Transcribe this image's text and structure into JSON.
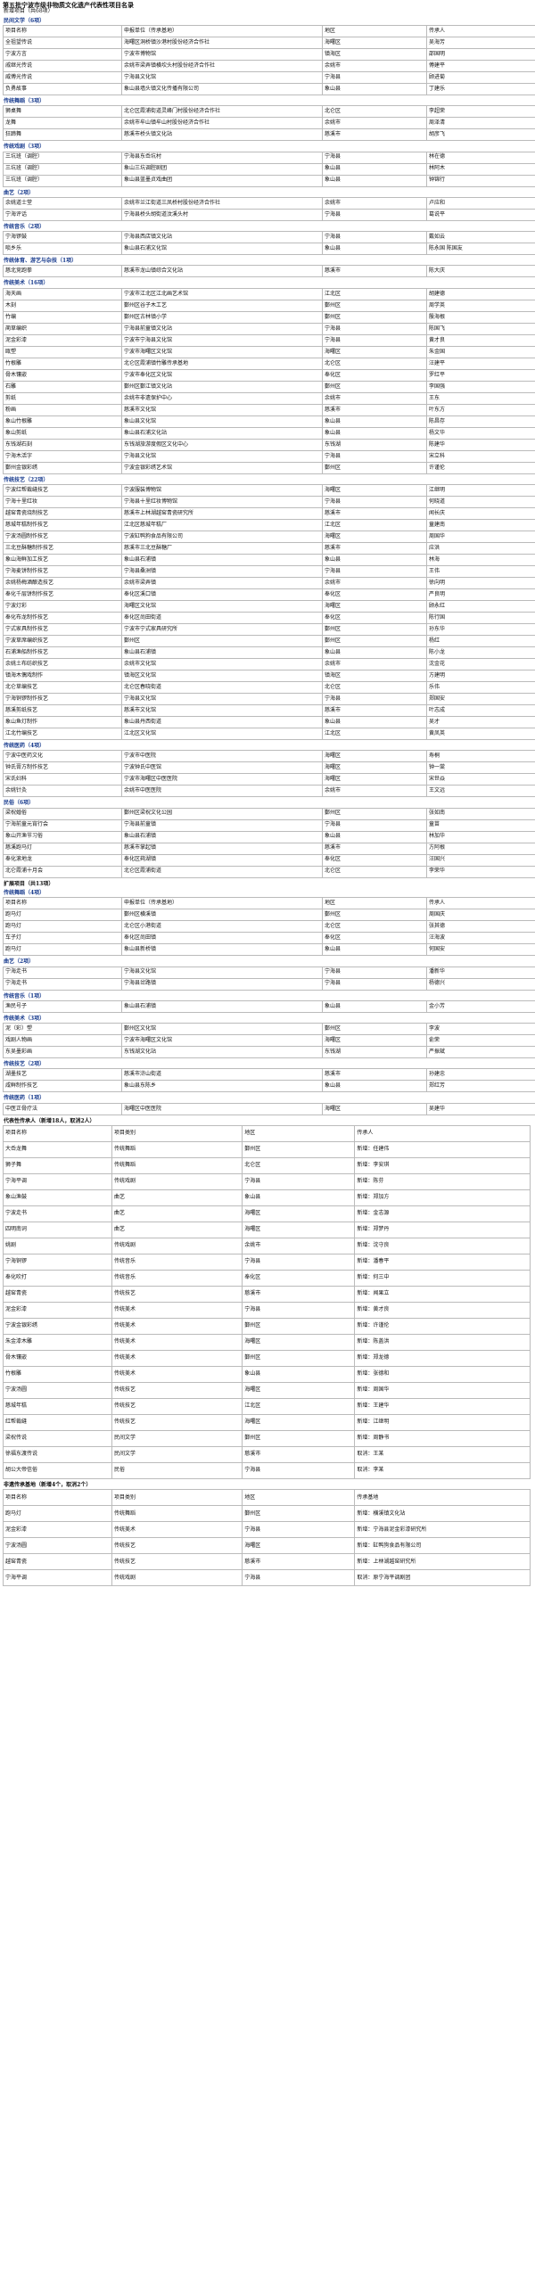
{
  "title": "第五批宁波市级非物质文化遗产代表性项目名录",
  "new_label": "新增项目（共68项）",
  "new_sections": [
    {
      "name": "民间文学（6项）",
      "rows": [
        [
          "项目名称",
          "申报单位（传承基地）",
          "地区",
          "传承人"
        ],
        [
          "全祖望传说",
          "海曙区洞桥镇沙港村股份经济合作社",
          "海曙区",
          "吴海芳"
        ],
        [
          "宁波方言",
          "宁波市博物馆",
          "镇海区",
          "邵国明"
        ],
        [
          "戚继光传说",
          "余姚市梁弄镇横坎头村股份经济合作社",
          "余姚市",
          "傅建平"
        ],
        [
          "威傅光传说",
          "宁海县文化馆",
          "宁海县",
          "顾进菊"
        ],
        [
          "负勇故事",
          "象山县墙头镇文化传播有限公司",
          "象山县",
          "丁建乐"
        ]
      ]
    },
    {
      "name": "传统舞蹈（3项）",
      "rows": [
        [
          "狮桌舞",
          "北仑区霞浦街道灵峰门村股份经济合作社",
          "北仑区",
          "李超荣"
        ],
        [
          "龙舞",
          "余姚市牟山镇牟山村股份经济合作社",
          "余姚市",
          "周泽清"
        ],
        [
          "狂蹄舞",
          "慈溪市桥头镇文化站",
          "慈溪市",
          "胡彦飞"
        ]
      ]
    },
    {
      "name": "传统戏剧（3项）",
      "rows": [
        [
          "三坑班（调腔）",
          "宁海县东岙坑村",
          "宁海县",
          "林在德"
        ],
        [
          "三坑班（调腔）",
          "象山三坑调腔剧团",
          "象山县",
          "林阿木"
        ],
        [
          "三坑班（调腔）",
          "象山县蓝墨贞戏曲团",
          "象山县",
          "钟锦行"
        ]
      ]
    },
    {
      "name": "曲艺（2项）",
      "rows": [
        [
          "余姚道士堂",
          "余姚市兰江街道三凤桥村股份经济合作社",
          "余姚市",
          "卢应和"
        ],
        [
          "宁海评话",
          "宁海县桥头胡街道汶溪头村",
          "宁海县",
          "葛说平"
        ]
      ]
    },
    {
      "name": "传统音乐（2项）",
      "rows": [
        [
          "宁海锣鼓",
          "宁海县西店镇文化站",
          "宁海县",
          "戴如云"
        ],
        [
          "唢乡乐",
          "象山县石浦文化馆",
          "象山县",
          "陈永国 陈国友"
        ]
      ]
    },
    {
      "name": "传统体育、游艺与杂技（1项）",
      "rows": [
        [
          "慈北竞跑拳",
          "慈溪市龙山镇综合文化站",
          "慈溪市",
          "陈大庆"
        ]
      ]
    },
    {
      "name": "传统美术（16项）",
      "rows": [
        [
          "海天画",
          "宁波市江北区江北画艺术馆",
          "江北区",
          "胡建德"
        ],
        [
          "木刻",
          "鄞州区谷子木工艺",
          "鄞州区",
          "周学英"
        ],
        [
          "竹编",
          "鄞州区古林镇小学",
          "鄞州区",
          "殷海根"
        ],
        [
          "蔺草编织",
          "宁海县前童镇文化站",
          "宁海县",
          "陈国飞"
        ],
        [
          "泥金彩漆",
          "宁波市宁海县文化馆",
          "宁海县",
          "黄才良"
        ],
        [
          "瓯塑",
          "宁波市海曙区文化馆",
          "海曙区",
          "朱金国"
        ],
        [
          "竹根雕",
          "北仑区霞浦镇竹雕传承基地",
          "北仑区",
          "汪建平"
        ],
        [
          "骨木镶嵌",
          "宁波市奉化区文化馆",
          "奉化区",
          "罗红平"
        ],
        [
          "石雕",
          "鄞州区鄞江镇文化站",
          "鄞州区",
          "李国强"
        ],
        [
          "剪纸",
          "余姚市非遗保护中心",
          "余姚市",
          "王东"
        ],
        [
          "粉画",
          "慈溪市文化馆",
          "慈溪市",
          "叶东方"
        ],
        [
          "象山竹根雕",
          "象山县文化馆",
          "象山县",
          "陈昌存"
        ],
        [
          "象山剪纸",
          "象山县石浦文化站",
          "象山县",
          "杨文华"
        ],
        [
          "东钱湖石刻",
          "东钱湖旅游度假区文化中心",
          "东钱湖",
          "陈建华"
        ],
        [
          "宁海木活字",
          "宁海县文化馆",
          "宁海县",
          "宋立科"
        ],
        [
          "鄞州金银彩绣",
          "宁波金银彩绣艺术馆",
          "鄞州区",
          "许谨伦"
        ]
      ]
    },
    {
      "name": "传统技艺（22项）",
      "rows": [
        [
          "宁波红帮裁缝技艺",
          "宁波服装博物馆",
          "海曙区",
          "江继明"
        ],
        [
          "宁海十里红妆",
          "宁海县十里红妆博物馆",
          "宁海县",
          "何晓道"
        ],
        [
          "越窑青瓷烧制技艺",
          "慈溪市上林湖越窑青瓷研究所",
          "慈溪市",
          "闻长庆"
        ],
        [
          "慈城年糕制作技艺",
          "江北区慈城年糕厂",
          "江北区",
          "童建南"
        ],
        [
          "宁波汤圆制作技艺",
          "宁波缸鸭狗食品有限公司",
          "海曙区",
          "周国华"
        ],
        [
          "三北豆酥糖制作技艺",
          "慈溪市三北豆酥糖厂",
          "慈溪市",
          "应洪"
        ],
        [
          "象山海鲜加工技艺",
          "象山县石浦镇",
          "象山县",
          "林海"
        ],
        [
          "宁海麦饼制作技艺",
          "宁海县桑洲镇",
          "宁海县",
          "王伟"
        ],
        [
          "余姚杨梅酒酿造技艺",
          "余姚市梁弄镇",
          "余姚市",
          "徐向明"
        ],
        [
          "奉化千层饼制作技艺",
          "奉化区溪口镇",
          "奉化区",
          "严良明"
        ],
        [
          "宁波灯彩",
          "海曙区文化馆",
          "海曙区",
          "顾永红"
        ],
        [
          "奉化布龙制作技艺",
          "奉化区尚田街道",
          "奉化区",
          "陈行国"
        ],
        [
          "宁式家具制作技艺",
          "宁波市宁式家具研究所",
          "鄞州区",
          "孙东华"
        ],
        [
          "宁波草席编织技艺",
          "鄞州区",
          "鄞州区",
          "杨红"
        ],
        [
          "石浦渔船制作技艺",
          "象山县石浦镇",
          "象山县",
          "陈小龙"
        ],
        [
          "余姚土布纺织技艺",
          "余姚市文化馆",
          "余姚市",
          "沈金花"
        ],
        [
          "镇海木偶戏制作",
          "镇海区文化馆",
          "镇海区",
          "方建明"
        ],
        [
          "北仑草编技艺",
          "北仑区春晓街道",
          "北仑区",
          "乐伟"
        ],
        [
          "宁海铜锣制作技艺",
          "宁海县文化馆",
          "宁海县",
          "郑国安"
        ],
        [
          "慈溪剪纸技艺",
          "慈溪市文化馆",
          "慈溪市",
          "叶志成"
        ],
        [
          "象山鱼灯制作",
          "象山县丹西街道",
          "象山县",
          "吴才"
        ],
        [
          "江北竹编技艺",
          "江北区文化馆",
          "江北区",
          "黄凤英"
        ]
      ]
    },
    {
      "name": "传统医药（4项）",
      "rows": [
        [
          "宁波中医药文化",
          "宁波市中医院",
          "海曙区",
          "寿桐"
        ],
        [
          "钟氏膏方制作技艺",
          "宁波钟氏中医馆",
          "海曙区",
          "钟一棠"
        ],
        [
          "宋氏妇科",
          "宁波市海曙区中医医院",
          "海曙区",
          "宋世焱"
        ],
        [
          "余姚针灸",
          "余姚市中医医院",
          "余姚市",
          "王文远"
        ]
      ]
    },
    {
      "name": "民俗（6项）",
      "rows": [
        [
          "梁祝婚俗",
          "鄞州区梁祝文化公园",
          "鄞州区",
          "张如南"
        ],
        [
          "宁海前童元宵行会",
          "宁海县前童镇",
          "宁海县",
          "童苗"
        ],
        [
          "象山开渔节习俗",
          "象山县石浦镇",
          "象山县",
          "林加华"
        ],
        [
          "慈溪跑马灯",
          "慈溪市掌起镇",
          "慈溪市",
          "方阿根"
        ],
        [
          "奉化滚地龙",
          "奉化区莼湖镇",
          "奉化区",
          "汪国兴"
        ],
        [
          "北仑霞浦十月会",
          "北仑区霞浦街道",
          "北仑区",
          "李荣华"
        ]
      ]
    }
  ],
  "ext_label": "扩展项目（共13项）",
  "ext_sections": [
    {
      "name": "传统舞蹈（4项）",
      "rows": [
        [
          "项目名称",
          "申报单位（传承基地）",
          "地区",
          "传承人"
        ],
        [
          "跑马灯",
          "鄞州区横溪镇",
          "鄞州区",
          "周国庆"
        ],
        [
          "跑马灯",
          "北仑区小港街道",
          "北仑区",
          "张其德"
        ],
        [
          "车子灯",
          "奉化区尚田镇",
          "奉化区",
          "汪海波"
        ],
        [
          "跑马灯",
          "象山县新桥镇",
          "象山县",
          "何国安"
        ]
      ]
    },
    {
      "name": "曲艺（2项）",
      "rows": [
        [
          "宁海走书",
          "宁海县文化馆",
          "宁海县",
          "潘新华"
        ],
        [
          "宁海走书",
          "宁海县岔路镇",
          "宁海县",
          "杨德兴"
        ]
      ]
    },
    {
      "name": "传统音乐（1项）",
      "rows": [
        [
          "渔民号子",
          "象山县石浦镇",
          "象山县",
          "金小芳"
        ]
      ]
    },
    {
      "name": "传统美术（3项）",
      "rows": [
        [
          "泥（彩）塑",
          "鄞州区文化馆",
          "鄞州区",
          "李波"
        ],
        [
          "戏剧人物画",
          "宁波市海曙区文化馆",
          "海曙区",
          "俞荣"
        ],
        [
          "东吴墨彩画",
          "东钱湖文化站",
          "东钱湖",
          "严振斌"
        ]
      ]
    },
    {
      "name": "传统技艺（2项）",
      "rows": [
        [
          "湖墨技艺",
          "慈溪市浒山街道",
          "慈溪市",
          "孙建忠"
        ],
        [
          "咸鲜制作技艺",
          "象山县东陈乡",
          "象山县",
          "郑红芳"
        ]
      ]
    },
    {
      "name": "传统医药（1项）",
      "rows": [
        [
          "中医正骨疗法",
          "海曙区中医医院",
          "海曙区",
          "吴建华"
        ]
      ]
    }
  ],
  "rep_label": "代表性传承人（新增18人，取消2人）",
  "rep_rows": [
    [
      "项目名称",
      "项目类别",
      "地区",
      "传承人"
    ],
    [
      "大岙龙舞",
      "传统舞蹈",
      "鄞州区",
      "新增：任建伟"
    ],
    [
      "狮子舞",
      "传统舞蹈",
      "北仑区",
      "新增：李安琪"
    ],
    [
      "宁海平调",
      "传统戏剧",
      "宁海县",
      "新增：陈芬"
    ],
    [
      "象山渔鼓",
      "曲艺",
      "象山县",
      "新增：郑加方"
    ],
    [
      "宁波走书",
      "曲艺",
      "海曙区",
      "新增：金志源"
    ],
    [
      "四明南词",
      "曲艺",
      "海曙区",
      "新增：郑梦丹"
    ],
    [
      "姚剧",
      "传统戏剧",
      "余姚市",
      "新增：沈守良"
    ],
    [
      "宁海铜锣",
      "传统音乐",
      "宁海县",
      "新增：潘春平"
    ],
    [
      "奉化吹打",
      "传统音乐",
      "奉化区",
      "新增：何三中"
    ],
    [
      "越窑青瓷",
      "传统技艺",
      "慈溪市",
      "新增：闻果立"
    ],
    [
      "泥金彩漆",
      "传统美术",
      "宁海县",
      "新增：黄才良"
    ],
    [
      "宁波金银彩绣",
      "传统美术",
      "鄞州区",
      "新增：许谨伦"
    ],
    [
      "朱金漆木雕",
      "传统美术",
      "海曙区",
      "新增：陈盖洪"
    ],
    [
      "骨木镶嵌",
      "传统美术",
      "鄞州区",
      "新增：郑龙德"
    ],
    [
      "竹根雕",
      "传统美术",
      "象山县",
      "新增：张德和"
    ],
    [
      "宁波汤圆",
      "传统技艺",
      "海曙区",
      "新增：周国华"
    ],
    [
      "慈城年糕",
      "传统技艺",
      "江北区",
      "新增：王建华"
    ],
    [
      "红帮裁缝",
      "传统技艺",
      "海曙区",
      "新增：江继明"
    ],
    [
      "梁祝传说",
      "民间文学",
      "鄞州区",
      "新增：周静书"
    ],
    [
      "徐福东渡传说",
      "民间文学",
      "慈溪市",
      "取消：王某"
    ],
    [
      "胡公大帝信俗",
      "民俗",
      "宁海县",
      "取消：李某"
    ]
  ],
  "base_label": "非遗传承基地（新增4个，取消2个）",
  "base_rows": [
    [
      "项目名称",
      "项目类别",
      "地区",
      "传承基地"
    ],
    [
      "跑马灯",
      "传统舞蹈",
      "鄞州区",
      "新增：横溪镇文化站"
    ],
    [
      "泥金彩漆",
      "传统美术",
      "宁海县",
      "新增：宁海县泥金彩漆研究所"
    ],
    [
      "宁波汤圆",
      "传统技艺",
      "海曙区",
      "新增：缸鸭狗食品有限公司"
    ],
    [
      "越窑青瓷",
      "传统技艺",
      "慈溪市",
      "新增：上林湖越窑研究所"
    ],
    [
      "宁海平调",
      "传统戏剧",
      "宁海县",
      "取消：原宁海平调剧团"
    ]
  ]
}
